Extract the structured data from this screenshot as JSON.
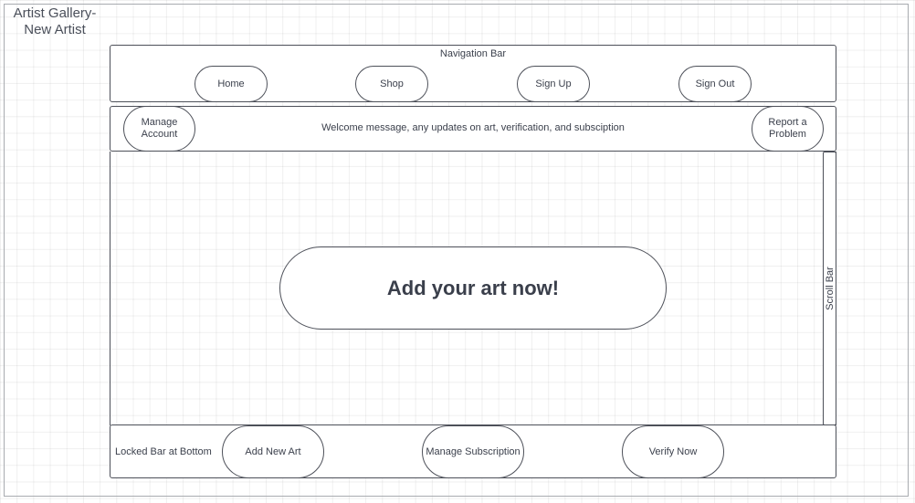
{
  "page": {
    "title": "Artist Gallery-\nNew Artist"
  },
  "nav": {
    "title": "Navigation Bar",
    "buttons": [
      "Home",
      "Shop",
      "Sign Up",
      "Sign Out"
    ]
  },
  "welcome": {
    "manage_account": "Manage\nAccount",
    "message": "Welcome message, any updates on art, verification, and subsciption",
    "report_problem": "Report a\nProblem"
  },
  "main": {
    "cta": "Add your art now!",
    "scroll_label": "Scroll Bar"
  },
  "bottom": {
    "label": "Locked Bar at Bottom",
    "buttons": [
      "Add New Art",
      "Manage Subscription",
      "Verify Now"
    ]
  }
}
